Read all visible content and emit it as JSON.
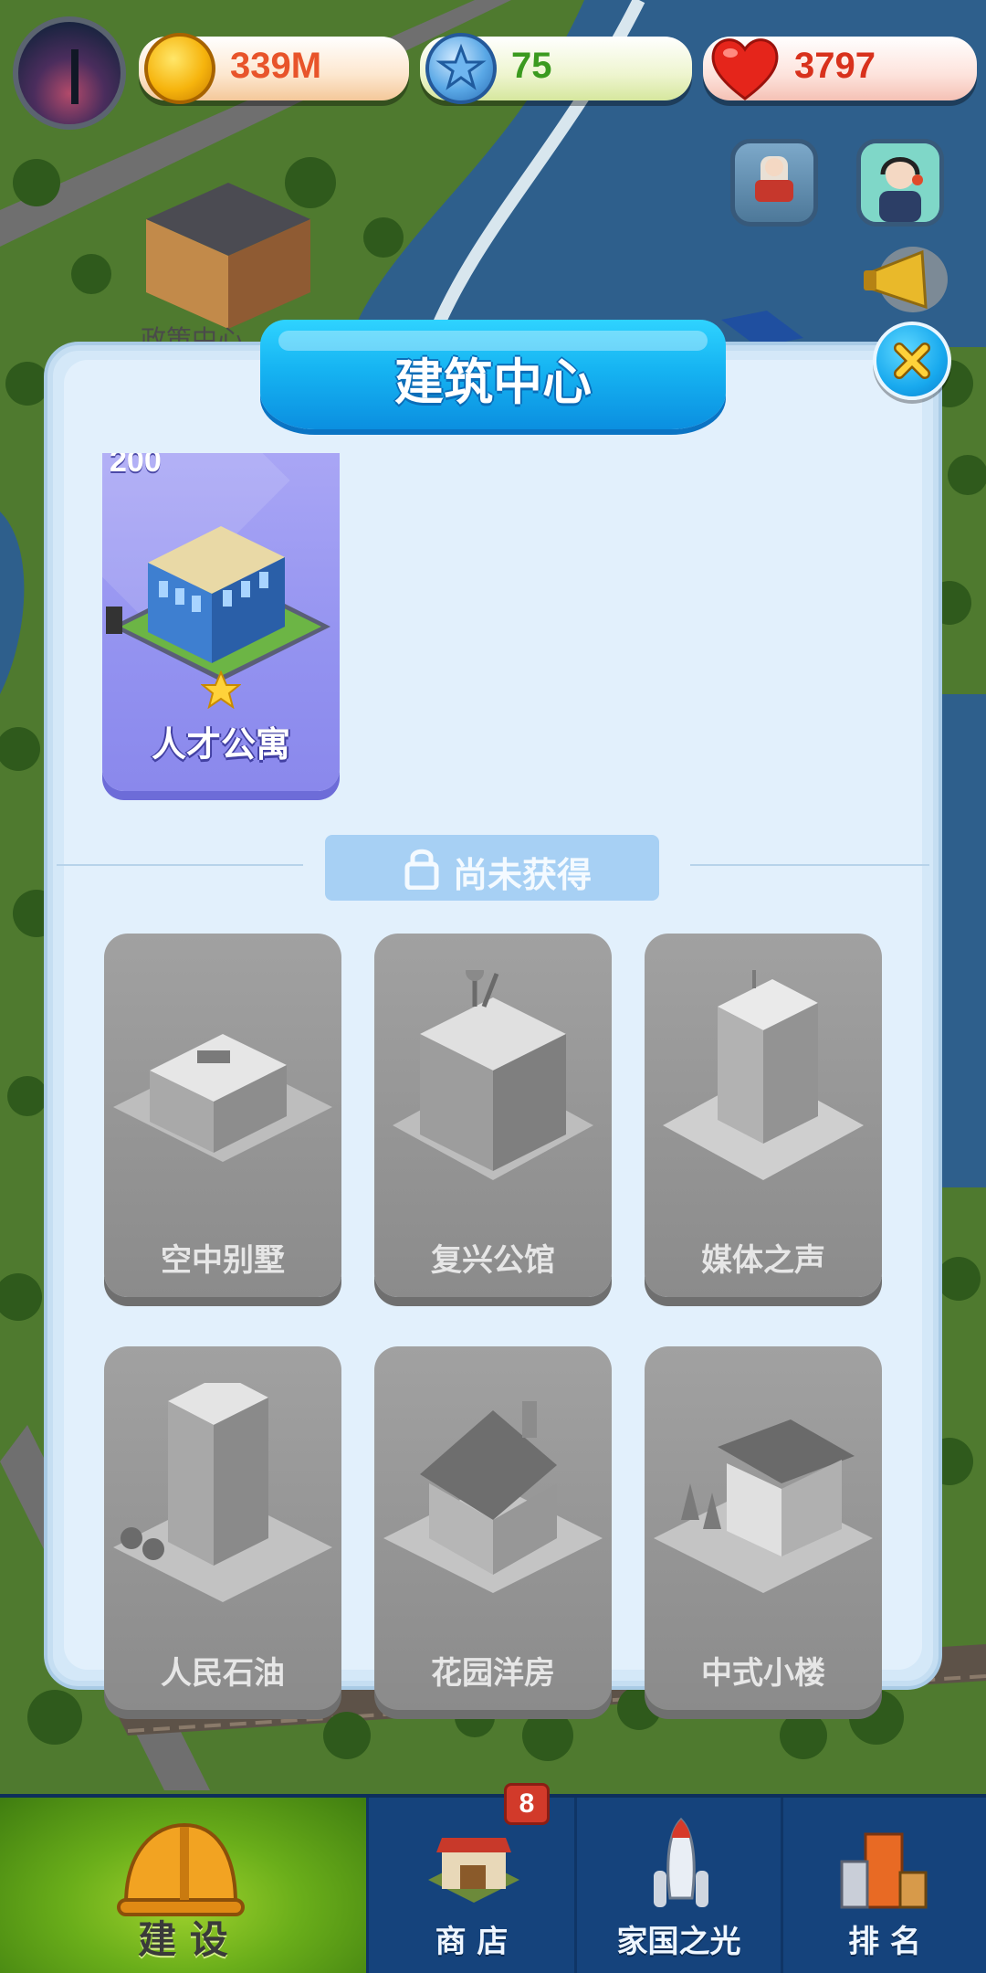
{
  "hud": {
    "coins": "339M",
    "stars": "75",
    "hearts": "3797"
  },
  "background": {
    "building_caption": "政策中心"
  },
  "dialog": {
    "title": "建筑中心",
    "owned": [
      {
        "name": "人才公寓",
        "cost": "200",
        "stars": 1
      }
    ],
    "locked_section_label": "尚未获得",
    "locked": [
      {
        "name": "空中别墅"
      },
      {
        "name": "复兴公馆"
      },
      {
        "name": "媒体之声"
      },
      {
        "name": "人民石油"
      },
      {
        "name": "花园洋房"
      },
      {
        "name": "中式小楼"
      }
    ]
  },
  "nav": {
    "tabs": [
      {
        "label": "建 设",
        "active": true
      },
      {
        "label": "商 店",
        "badge": "8"
      },
      {
        "label": "家国之光"
      },
      {
        "label": "排 名"
      }
    ]
  },
  "colors": {
    "accent_blue": "#16b4f2",
    "coin_text": "#e8542a",
    "star_text": "#3b9a1f",
    "heart_text": "#d8311c",
    "owned_card": "#9392f0",
    "locked_card": "#8b8b8b",
    "nav_bg": "#15437c",
    "nav_active": "#6aae1a"
  }
}
